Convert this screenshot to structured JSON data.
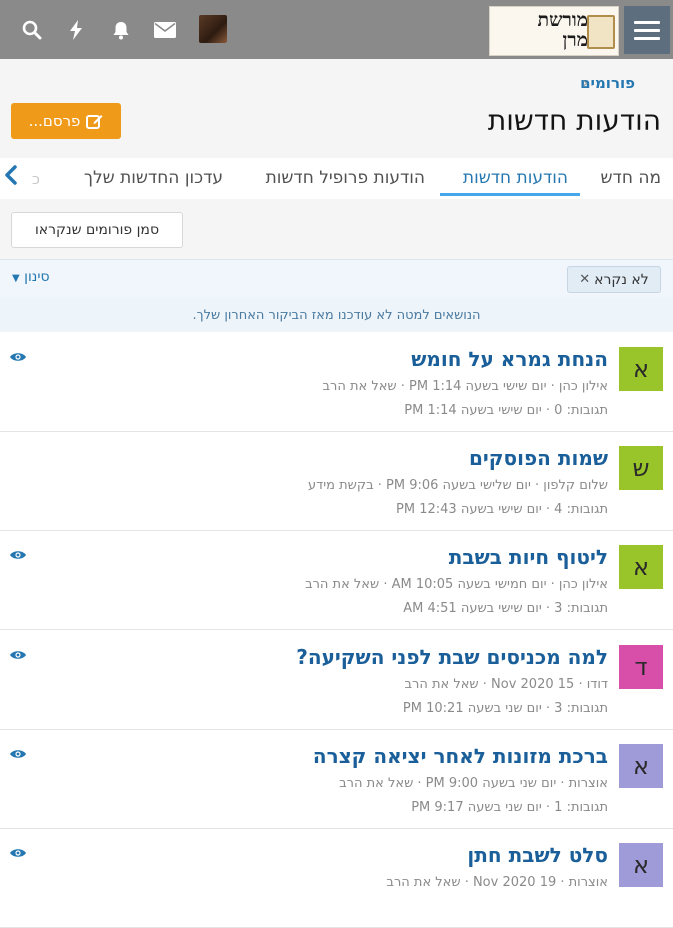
{
  "colors": {
    "topbar": "#8a8a8a",
    "link": "#2577b1",
    "accent_orange": "#f09a1a",
    "tab_underline": "#47a7eb",
    "avatar_green": "#9ac52a",
    "avatar_pink": "#d84faa",
    "avatar_purple": "#9f9ad8"
  },
  "topbar": {
    "icons": [
      "search-icon",
      "bolt-icon",
      "bell-icon",
      "envelope-icon",
      "user-avatar"
    ],
    "logo_line1": "מורשת",
    "logo_line2": "מרן"
  },
  "breadcrumb": {
    "label": "פורומים"
  },
  "page": {
    "title": "הודעות חדשות",
    "post_button": "פרסם..."
  },
  "tabs": [
    {
      "label": "מה חדש",
      "active": false
    },
    {
      "label": "הודעות חדשות",
      "active": true
    },
    {
      "label": "הודעות פרופיל חדשות",
      "active": false
    },
    {
      "label": "עדכון החדשות שלך",
      "active": false
    }
  ],
  "mark_read_button": "סמן פורומים שנקראו",
  "filter": {
    "chip_label": "לא נקרא",
    "label": "סינון"
  },
  "notice": "הנושאים למטה לא עודכנו מאז הביקור האחרון שלך.",
  "threads": [
    {
      "letter": "א",
      "color": "#9ac52a",
      "title": "הנחת גמרא על חומש",
      "meta": "אילון כהן · יום שישי בשעה 1:14 PM · שאל את הרב",
      "stats": "תגובות: 0 · יום שישי בשעה 1:14 PM",
      "watched": true
    },
    {
      "letter": "ש",
      "color": "#9ac52a",
      "title": "שמות הפוסקים",
      "meta": "שלום קלפון · יום שלישי בשעה 9:06 PM · בקשת מידע",
      "stats": "תגובות: 4 · יום שישי בשעה 12:43 PM",
      "watched": false
    },
    {
      "letter": "א",
      "color": "#9ac52a",
      "title": "ליטוף חיות בשבת",
      "meta": "אילון כהן · יום חמישי בשעה 10:05 AM · שאל את הרב",
      "stats": "תגובות: 3 · יום שישי בשעה 4:51 AM",
      "watched": true
    },
    {
      "letter": "ד",
      "color": "#d84faa",
      "title": "למה מכניסים שבת לפני השקיעה?",
      "meta": "דודו · 15 Nov 2020 · שאל את הרב",
      "stats": "תגובות: 3 · יום שני בשעה 10:21 PM",
      "watched": true
    },
    {
      "letter": "א",
      "color": "#9f9ad8",
      "title": "ברכת מזונות לאחר יציאה קצרה",
      "meta": "אוצרות · יום שני בשעה 9:00 PM · שאל את הרב",
      "stats": "תגובות: 1 · יום שני בשעה 9:17 PM",
      "watched": true
    },
    {
      "letter": "א",
      "color": "#9f9ad8",
      "title": "סלט לשבת חתן",
      "meta": "אוצרות · 19 Nov 2020 · שאל את הרב",
      "stats": "",
      "watched": true
    }
  ]
}
